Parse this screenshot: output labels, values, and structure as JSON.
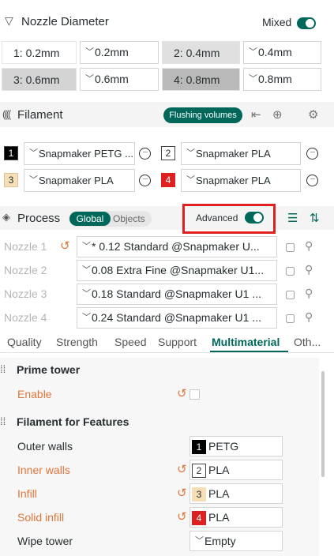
{
  "nozzle": {
    "title": "Nozzle Diameter",
    "mixed_label": "Mixed",
    "rows": [
      {
        "label": "1: 0.2mm",
        "value": "0.2mm"
      },
      {
        "label": "2: 0.4mm",
        "value": "0.4mm"
      },
      {
        "label": "3: 0.6mm",
        "value": "0.6mm"
      },
      {
        "label": "4: 0.8mm",
        "value": "0.8mm"
      }
    ]
  },
  "filament": {
    "title": "Filament",
    "flushing_label": "Flushing volumes",
    "items": [
      {
        "index": "1",
        "name": "Snapmaker PETG ...",
        "color": "#000000",
        "text_color": "#ffffff"
      },
      {
        "index": "2",
        "name": "Snapmaker PLA",
        "color": "#ffffff",
        "text_color": "#262e30"
      },
      {
        "index": "3",
        "name": "Snapmaker PLA",
        "color": "#f6dfb6",
        "text_color": "#262e30"
      },
      {
        "index": "4",
        "name": "Snapmaker PLA",
        "color": "#e02020",
        "text_color": "#ffffff"
      }
    ]
  },
  "process": {
    "title": "Process",
    "global_label": "Global",
    "objects_label": "Objects",
    "advanced_label": "Advanced",
    "nozzles": [
      {
        "label": "Nozzle 1",
        "value": "* 0.12 Standard @Snapmaker U..."
      },
      {
        "label": "Nozzle 2",
        "value": "0.08 Extra Fine @Snapmaker U1..."
      },
      {
        "label": "Nozzle 3",
        "value": "0.18 Standard @Snapmaker U1 ..."
      },
      {
        "label": "Nozzle 4",
        "value": "0.24 Standard @Snapmaker U1 ..."
      }
    ]
  },
  "tabs": [
    "Quality",
    "Strength",
    "Speed",
    "Support",
    "Multimaterial",
    "Oth..."
  ],
  "prime_tower": {
    "title": "Prime tower",
    "enable_label": "Enable"
  },
  "features": {
    "title": "Filament for Features",
    "rows": [
      {
        "label": "Outer walls",
        "badge": "1",
        "value": "PETG"
      },
      {
        "label": "Inner walls",
        "badge": "2",
        "value": "PLA"
      },
      {
        "label": "Infill",
        "badge": "3",
        "value": "PLA"
      },
      {
        "label": "Solid infill",
        "badge": "4",
        "value": "PLA"
      },
      {
        "label": "Wipe tower",
        "badge": "",
        "value": "Empty"
      }
    ]
  },
  "colors": {
    "accent": "#00675b",
    "modified": "#e0763a",
    "highlight_box": "#e02020"
  }
}
